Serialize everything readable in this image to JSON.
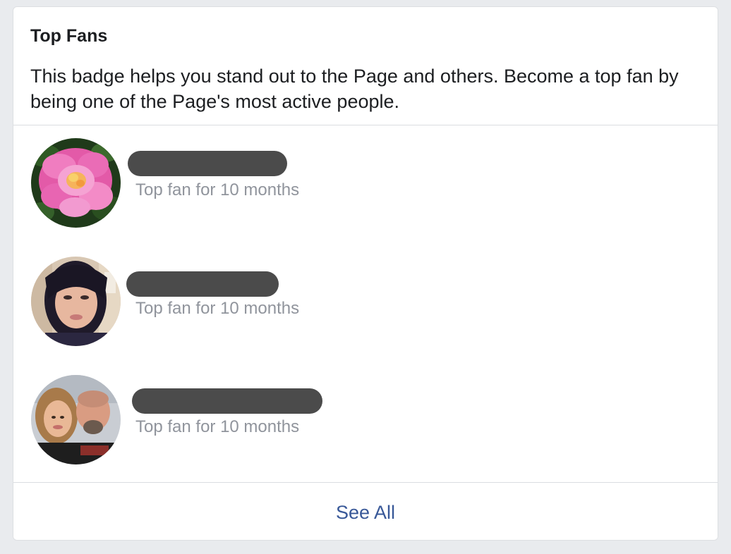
{
  "card": {
    "title": "Top Fans",
    "description": "This badge helps you stand out to the Page and others. Become a top fan by being one of the Page's most active people."
  },
  "fans": [
    {
      "avatar_icon": "flower-avatar",
      "name": "",
      "status": "Top fan for 10 months"
    },
    {
      "avatar_icon": "woman-avatar",
      "name": "",
      "status": "Top fan for 10 months"
    },
    {
      "avatar_icon": "couple-avatar",
      "name": "",
      "status": "Top fan for 10 months"
    }
  ],
  "footer": {
    "see_all_label": "See All"
  },
  "colors": {
    "background": "#e9ebee",
    "link": "#385898",
    "secondary_text": "#90949c",
    "redaction": "#4b4b4b"
  }
}
